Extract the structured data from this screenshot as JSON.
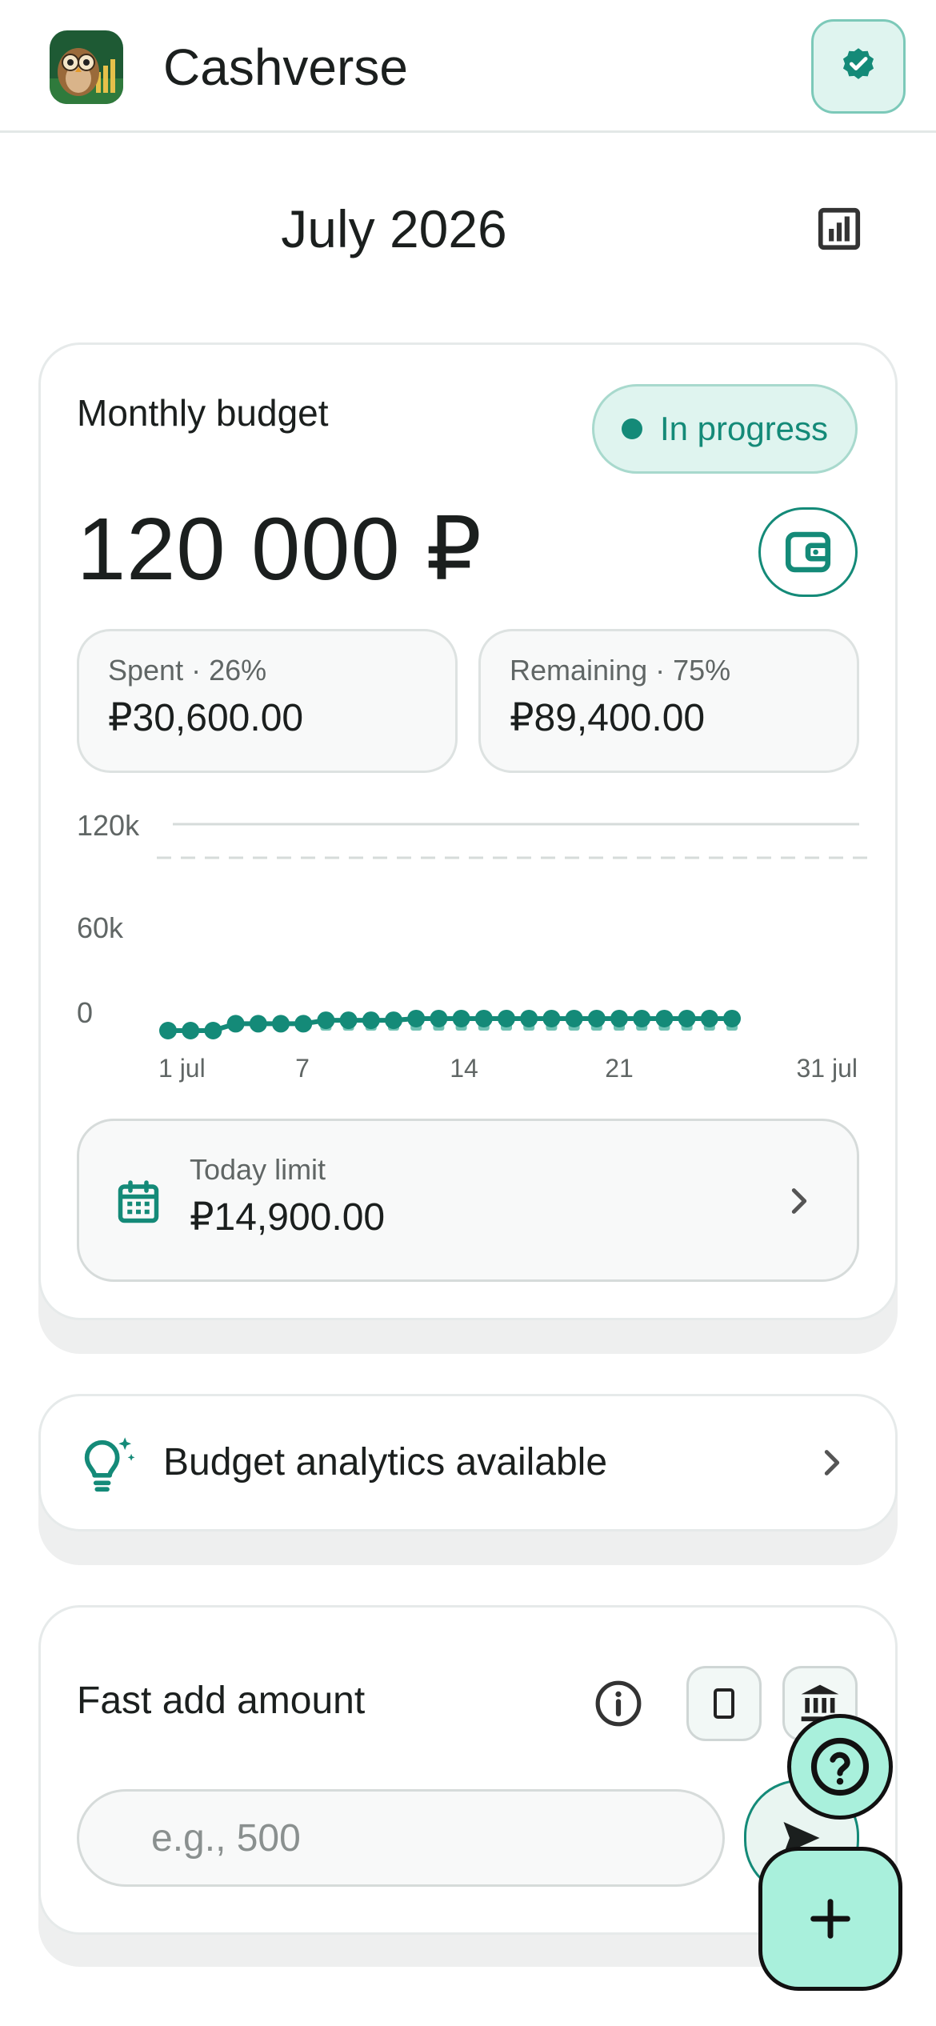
{
  "header": {
    "app_title": "Cashverse",
    "logo_icon": "owl-logo-icon",
    "verified_icon": "verified-badge-icon"
  },
  "month": {
    "title": "July 2026",
    "stats_icon": "bar-chart-icon"
  },
  "budget": {
    "label": "Monthly budget",
    "status": "In progress",
    "amount": "120 000 ₽",
    "spent_label": "Spent · 26%",
    "spent_value": "₽30,600.00",
    "remaining_label": "Remaining · 75%",
    "remaining_value": "₽89,400.00",
    "today_limit_label": "Today limit",
    "today_limit_value": "₽14,900.00"
  },
  "chart_data": {
    "type": "line",
    "y_tick_labels": [
      "120k",
      "60k",
      "0"
    ],
    "x_tick_labels": [
      "1 jul",
      "7",
      "14",
      "21",
      "31 jul"
    ],
    "ylim": [
      0,
      120000
    ],
    "reference_line": 120000,
    "series": [
      {
        "values": [
          0,
          0,
          0,
          4000,
          4000,
          4000,
          4000,
          6000,
          6000,
          6000,
          6000,
          7000,
          7000,
          7000,
          7000,
          7000,
          7000,
          7000,
          7000,
          7000,
          7000,
          7000,
          7000,
          7000,
          7000,
          7000
        ]
      }
    ],
    "grid": false,
    "legend": "none"
  },
  "analytics": {
    "text": "Budget analytics available"
  },
  "fast_add": {
    "title": "Fast add amount",
    "placeholder": "e.g., 500"
  },
  "colors": {
    "accent": "#148a78",
    "accent_light": "#dff4ef",
    "fab": "#a9f0dc",
    "bar": "#6fc2b3"
  }
}
